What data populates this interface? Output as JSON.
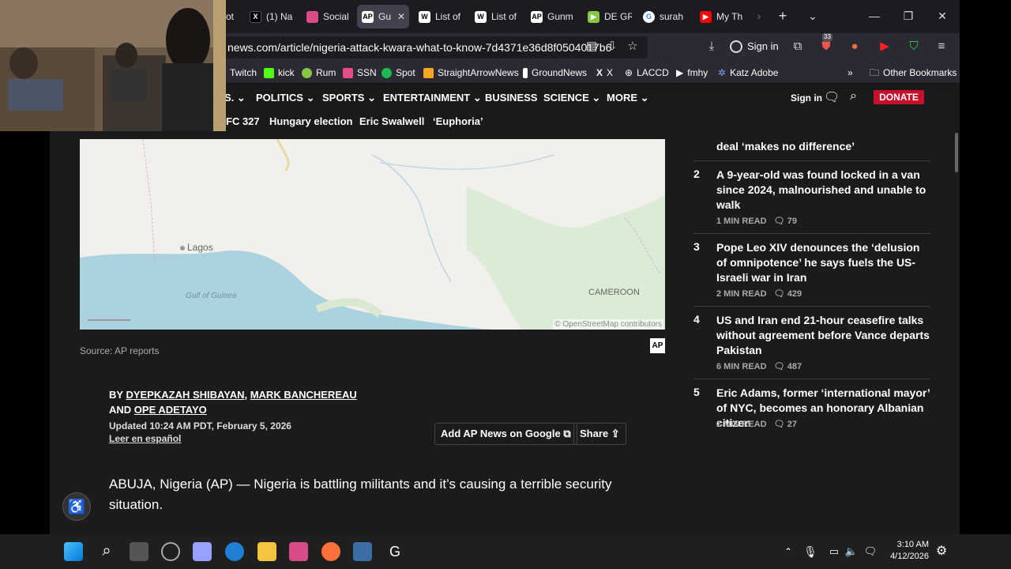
{
  "browser": {
    "tabs": [
      {
        "label": "ot",
        "icon": "tab-icon"
      },
      {
        "label": "(1) Na",
        "icon": "x-icon"
      },
      {
        "label": "Social",
        "icon": "social-icon"
      },
      {
        "label": "Gu",
        "icon": "ap-icon"
      },
      {
        "label": "List of",
        "icon": "wikipedia-icon"
      },
      {
        "label": "List of",
        "icon": "wikipedia-icon"
      },
      {
        "label": "Gunm",
        "icon": "ap-icon"
      },
      {
        "label": "DE GR",
        "icon": "rumble-icon"
      },
      {
        "label": "surah",
        "icon": "google-icon"
      },
      {
        "label": "My Th",
        "icon": "youtube-icon"
      }
    ],
    "url_main": "news.com/article/nigeria-attack-kwara-what-to-know-7d4371e36d8f0504017b6",
    "sign_in_label": "Sign in",
    "extension_badge": "33",
    "bookmarks": [
      {
        "label": "Twitch",
        "color": "#9146ff"
      },
      {
        "label": "kick",
        "color": "#53fc18"
      },
      {
        "label": "Rum",
        "color": "#85c742"
      },
      {
        "label": "SSN",
        "color": "#e44d8a"
      },
      {
        "label": "Spot",
        "color": "#1db954"
      },
      {
        "label": "StraightArrowNews",
        "color": "#f5a623"
      },
      {
        "label": "GroundNews",
        "color": "#ffffff"
      },
      {
        "label": "X",
        "color": "#ffffff"
      },
      {
        "label": "LACCD",
        "color": "#ffffff"
      },
      {
        "label": "fmhy",
        "color": "#ffffff"
      },
      {
        "label": "Katz Adobe",
        "color": "#7aa7ff"
      }
    ],
    "other_bookmarks": "Other Bookmarks"
  },
  "site": {
    "nav": [
      {
        "label": "S.",
        "has_dropdown": true
      },
      {
        "label": "POLITICS",
        "has_dropdown": true
      },
      {
        "label": "SPORTS",
        "has_dropdown": true
      },
      {
        "label": "ENTERTAINMENT",
        "has_dropdown": true
      },
      {
        "label": "BUSINESS",
        "has_dropdown": false
      },
      {
        "label": "SCIENCE",
        "has_dropdown": true
      },
      {
        "label": "MORE",
        "has_dropdown": true
      }
    ],
    "sign_in": "Sign in",
    "donate": "DONATE",
    "trending": [
      "FC 327",
      "Hungary election",
      "Eric Swalwell",
      "‘Euphoria’"
    ]
  },
  "map": {
    "labels": [
      "Lagos",
      "Gulf of Guinea",
      "CAMEROON"
    ],
    "attribution": "© OpenStreetMap contributors"
  },
  "article": {
    "source": "Source: AP reports",
    "ap_logo": "AP",
    "by": "BY",
    "author1": "DYEPKAZAH SHIBAYAN",
    "sep": ",",
    "author2": "MARK BANCHEREAU",
    "and": "AND",
    "author3": "OPE ADETAYO",
    "updated": "Updated 10:24 AM PDT, February 5, 2026",
    "leer": "Leer en español",
    "add_google": "Add AP News on Google",
    "share": "Share",
    "lede": "ABUJA, Nigeria (AP) — Nigeria is battling militants and it’s causing a terrible security situation."
  },
  "most_read": [
    {
      "num": "",
      "title": "deal ‘makes no difference’",
      "read": "",
      "comments": ""
    },
    {
      "num": "2",
      "title": "A 9-year-old was found locked in a van since 2024, malnourished and unable to walk",
      "read": "1 MIN READ",
      "comments": "79"
    },
    {
      "num": "3",
      "title": "Pope Leo XIV denounces the ‘delusion of omnipotence’ he says fuels the US-Israeli war in Iran",
      "read": "2 MIN READ",
      "comments": "429"
    },
    {
      "num": "4",
      "title": "US and Iran end 21-hour ceasefire talks without agreement before Vance departs Pakistan",
      "read": "6 MIN READ",
      "comments": "487"
    },
    {
      "num": "5",
      "title": "Eric Adams, former ‘international mayor’ of NYC, becomes an honorary Albanian citizen",
      "read": "2 MIN READ",
      "comments": "27"
    }
  ],
  "taskbar": {
    "time": "3:10 AM",
    "date": "4/12/2026"
  }
}
